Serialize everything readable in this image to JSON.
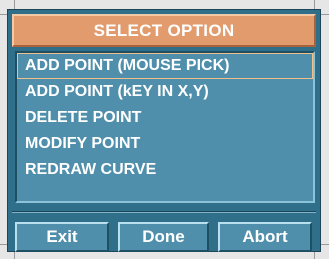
{
  "dialog": {
    "title": "SELECT OPTION",
    "options": [
      "ADD POINT (MOUSE PICK)",
      "ADD POINT (kEY IN X,Y)",
      "DELETE POINT",
      "MODIFY POINT",
      "REDRAW CURVE"
    ],
    "selected_index": 0,
    "buttons": {
      "exit": "Exit",
      "done": "Done",
      "abort": "Abort"
    }
  },
  "colors": {
    "panel": "#2f6f8a",
    "list_bg": "#4f8fab",
    "title_bg": "#e29b6d",
    "text": "#ffffff"
  }
}
